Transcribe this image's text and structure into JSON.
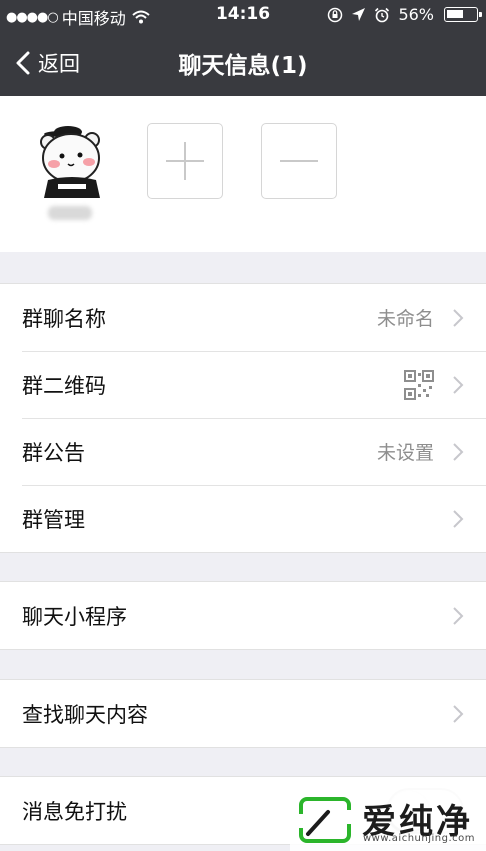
{
  "status_bar": {
    "signal_dots": "●●●●○",
    "carrier": "中国移动",
    "time": "14:16",
    "battery_percent": "56%",
    "battery_level": 0.56,
    "icons": [
      "wifi-icon",
      "orientation-lock-icon",
      "location-arrow-icon",
      "alarm-icon",
      "battery-icon"
    ]
  },
  "nav": {
    "back_label": "返回",
    "title": "聊天信息(1)"
  },
  "members": {
    "add_icon": "plus-icon",
    "remove_icon": "minus-icon"
  },
  "groups": [
    {
      "rows": [
        {
          "label": "群聊名称",
          "value": "未命名"
        },
        {
          "label": "群二维码",
          "icon": "qr-code-icon"
        },
        {
          "label": "群公告",
          "value": "未设置"
        },
        {
          "label": "群管理"
        }
      ]
    },
    {
      "rows": [
        {
          "label": "聊天小程序"
        }
      ]
    },
    {
      "rows": [
        {
          "label": "查找聊天内容"
        }
      ]
    },
    {
      "rows": [
        {
          "label": "消息免打扰",
          "toggle": false
        }
      ]
    }
  ],
  "watermark": {
    "title": "爱纯净",
    "url": "www.aichunjing.com"
  },
  "colors": {
    "header_bg": "#393a3f",
    "page_bg": "#efeff4",
    "watermark_green": "#2bb52b"
  }
}
